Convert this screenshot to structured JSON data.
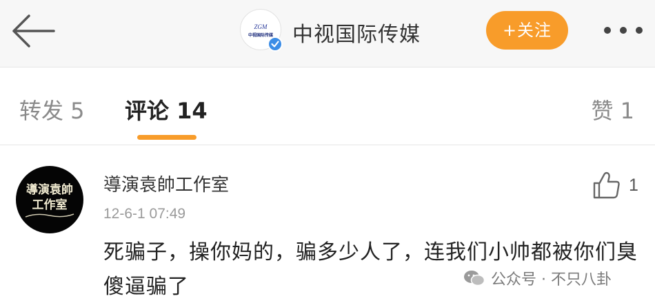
{
  "header": {
    "account_name": "中视国际传媒",
    "avatar_text_top": "ZGM",
    "avatar_text_bottom": "中视国际传媒",
    "follow_label": "+关注"
  },
  "tabs": {
    "repost": "转发 5",
    "comments": "评论 14",
    "likes": "赞 1"
  },
  "comment": {
    "username": "導演袁帥工作室",
    "avatar_line1": "導演袁帥",
    "avatar_line2": "工作室",
    "time": "12-6-1 07:49",
    "like_count": "1",
    "text": "死骗子，操你妈的，骗多少人了，连我们小帅都被你们臭傻逼骗了"
  },
  "watermark": "公众号 · 不只八卦",
  "colors": {
    "accent": "#f89c2a",
    "verified": "#3c8de6",
    "header_bg": "#f7f7f7"
  }
}
